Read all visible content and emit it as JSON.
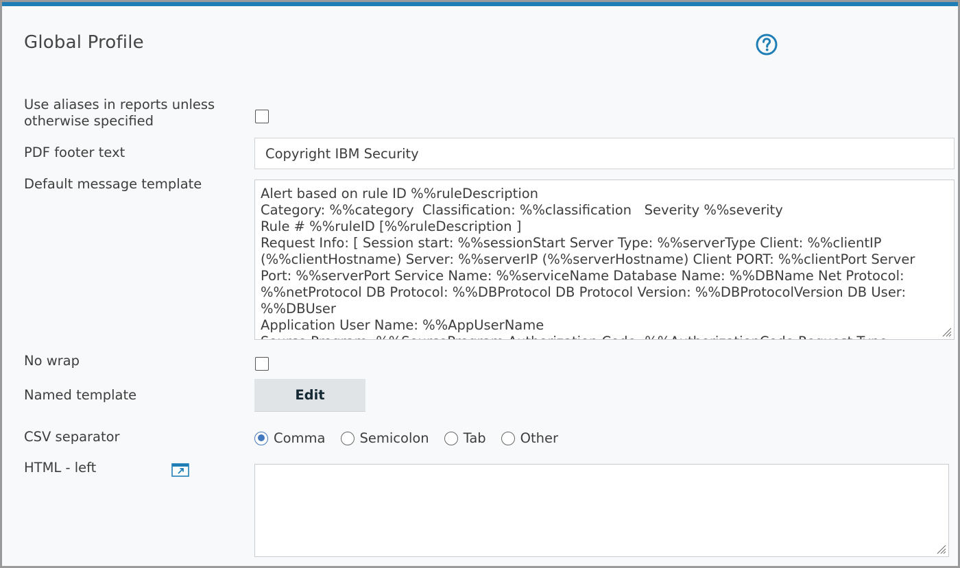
{
  "page": {
    "title": "Global Profile",
    "help_icon": "help-circle-icon"
  },
  "form": {
    "use_aliases": {
      "label": "Use aliases in reports unless otherwise specified",
      "checked": false
    },
    "pdf_footer": {
      "label": "PDF footer text",
      "value": "Copyright IBM Security"
    },
    "message_template": {
      "label": "Default message template",
      "lines": [
        "Alert based on rule ID %%ruleDescription",
        "Category: %%category  Classification: %%classification   Severity %%severity",
        "Rule # %%ruleID [%%ruleDescription ]",
        "Request Info: [ Session start: %%sessionStart Server Type: %%serverType Client: %%clientIP (%%clientHostname) Server: %%serverIP (%%serverHostname) Client PORT: %%clientPort Server Port: %%serverPort Service Name: %%serviceName Database Name: %%DBName Net Protocol: %%netProtocol DB Protocol: %%DBProtocol DB Protocol Version: %%DBProtocolVersion DB User: %%DBUser",
        "Application User Name: %%AppUserName",
        "Source Program: %%SourceProgram Authorization Code: %%AuthorizationCode Request Type"
      ]
    },
    "no_wrap": {
      "label": "No wrap",
      "checked": false
    },
    "named_template": {
      "label": "Named template",
      "button_label": "Edit"
    },
    "csv_separator": {
      "label": "CSV separator",
      "options": [
        "Comma",
        "Semicolon",
        "Tab",
        "Other"
      ],
      "selected": "Comma"
    },
    "html_left": {
      "label": "HTML - left",
      "icon": "popout-editor-icon",
      "value": ""
    }
  },
  "colors": {
    "accent": "#1f7eb5",
    "radio_selected": "#4178be",
    "button_bg": "#e1e4e7"
  }
}
